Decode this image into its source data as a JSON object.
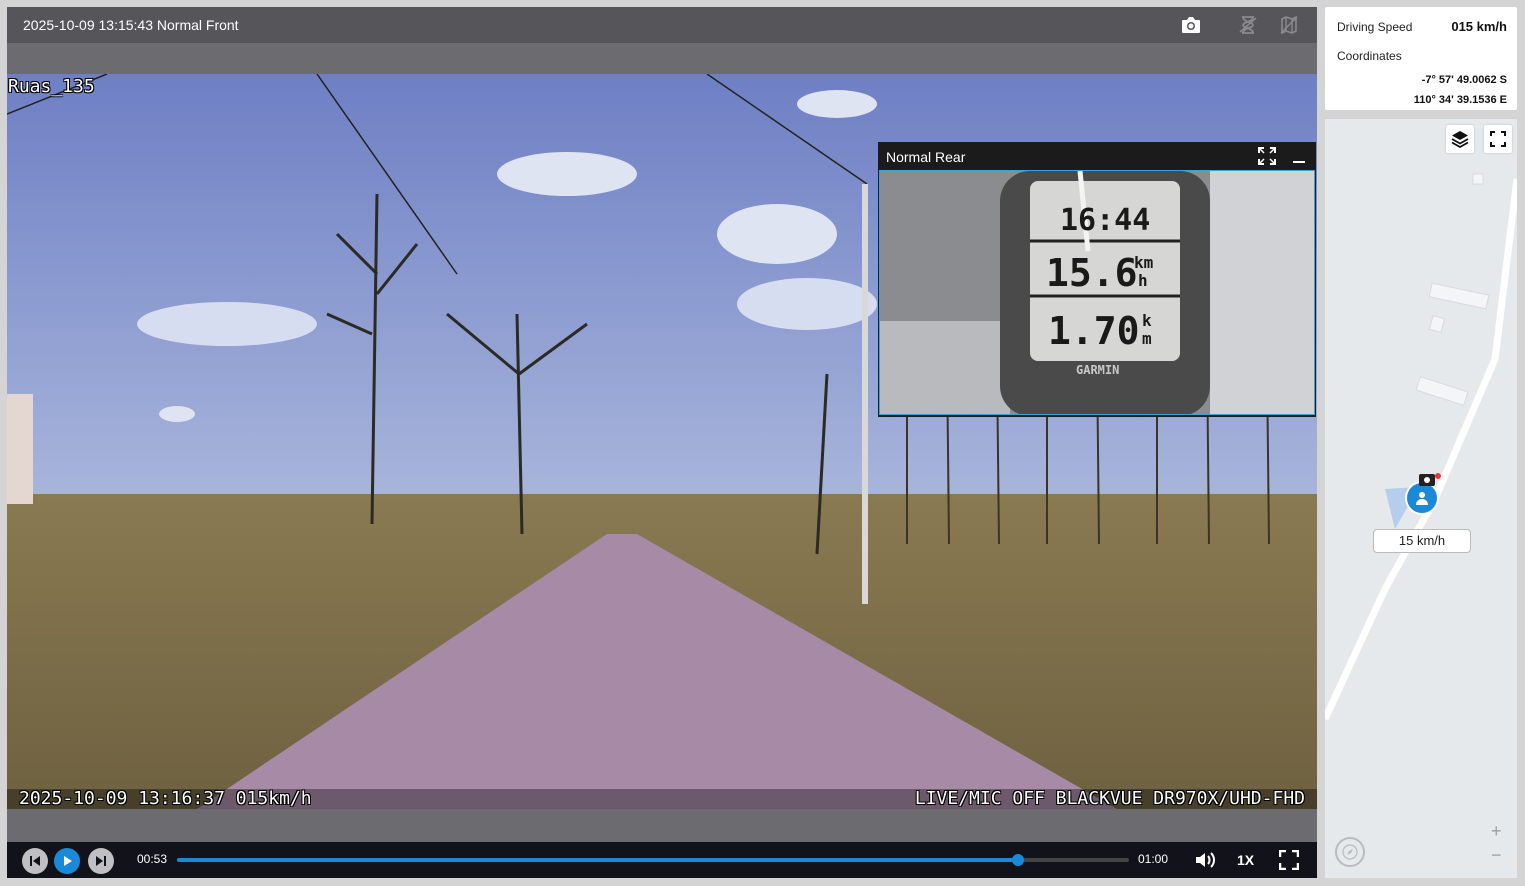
{
  "player": {
    "title": "2025-10-09 13:15:43 Normal Front",
    "icons": [
      "camera-icon",
      "hourglass-icon",
      "map-off-icon"
    ]
  },
  "video": {
    "channel_name": "Ruas_135",
    "timestamp_overlay": "2025-10-09 13:16:37 015km/h",
    "device_overlay": "LIVE/MIC OFF BLACKVUE DR970X/UHD-FHD"
  },
  "pip": {
    "label": "Normal Rear",
    "clock": "16:44",
    "speed": "15.6",
    "speed_unit_top": "km",
    "speed_unit_bottom": "h",
    "distance": "1.70",
    "distance_unit_top": "k",
    "distance_unit_bottom": "m",
    "brand": "GARMIN"
  },
  "controls": {
    "current_time": "00:53",
    "duration": "01:00",
    "progress": 0.883,
    "playback_rate": "1X"
  },
  "info": {
    "driving_speed_label": "Driving Speed",
    "driving_speed_value": "015 km/h",
    "coordinates_label": "Coordinates",
    "latitude": "-7° 57' 49.0062 S",
    "longitude": "110° 34' 39.1536 E"
  },
  "map": {
    "speed_tag": "15 km/h",
    "zoom_in": "+",
    "zoom_out": "−"
  },
  "colors": {
    "accent": "#1a8ad8",
    "topbar": "#56565a",
    "controls_bg": "#12121a"
  }
}
